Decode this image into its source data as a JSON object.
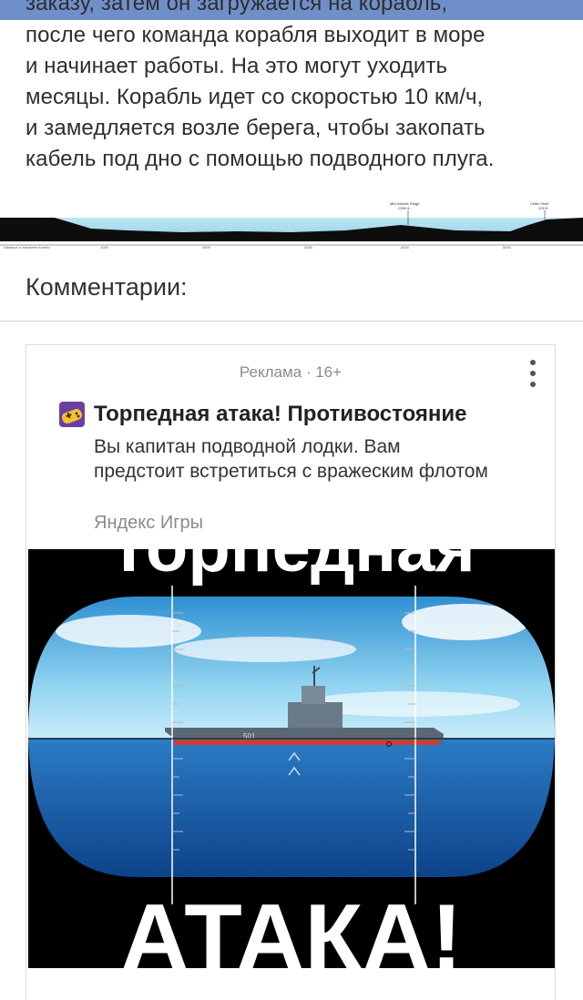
{
  "article": {
    "partial_line": "заказу, затем он загружается на корабль,",
    "lines": [
      "после чего команда корабля выходит в море",
      "и начинает работы. На это могут уходить",
      "месяцы. Корабль идет со скоростью 10 км/ч,",
      "и замедляется возле берега, чтобы закопать",
      "кабель под дно с помощью подводного плуга."
    ]
  },
  "profile_chart": {
    "left_caption": "Distance in kilometer from/to",
    "ticks": [
      "1000",
      "2000",
      "3000",
      "4000",
      "5000"
    ],
    "annotation_1": "Mid-Atlantic Ridge",
    "annotation_1_value": "-2200 ft",
    "annotation_2": "Celtic Shelf",
    "annotation_2_value": "-100 ft"
  },
  "comments": {
    "title": "Комментарии:"
  },
  "ad": {
    "label": "Реклама · 16+",
    "title": "Торпедная атака! Противостояние",
    "description": "Вы капитан подводной лодки. Вам предстоит встретиться с вражеским флотом",
    "source": "Яндекс Игры",
    "image_text_top": "Торпедная",
    "image_text_bottom": "АТАКА!",
    "ship_number": "501",
    "menu_icon": "more-vertical-icon",
    "app_icon": "gamepad-icon"
  },
  "colors": {
    "topbar": "#6f8fc9",
    "sea": "#1f5fa8",
    "sky": "#5ab8e8",
    "hull_red": "#d63a2c"
  }
}
